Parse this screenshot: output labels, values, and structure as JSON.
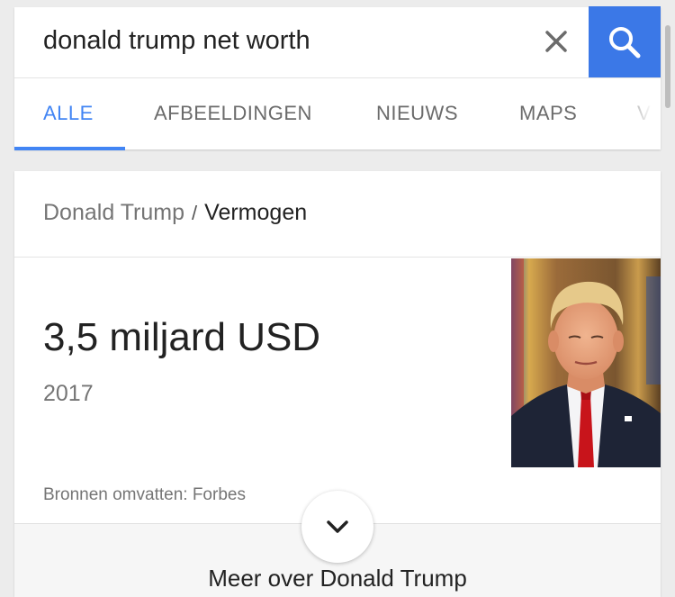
{
  "search": {
    "query": "donald trump net worth"
  },
  "tabs": [
    {
      "label": "ALLE",
      "active": true
    },
    {
      "label": "AFBEELDINGEN",
      "active": false
    },
    {
      "label": "NIEUWS",
      "active": false
    },
    {
      "label": "MAPS",
      "active": false
    },
    {
      "label": "VI",
      "active": false
    }
  ],
  "answer": {
    "breadcrumb_entity": "Donald Trump",
    "breadcrumb_separator": "/",
    "breadcrumb_attribute": "Vermogen",
    "value": "3,5 miljard USD",
    "year": "2017",
    "sources": "Bronnen omvatten: Forbes",
    "more_label": "Meer over Donald Trump"
  },
  "icons": {
    "clear": "close-icon",
    "search": "search-icon",
    "expand": "chevron-down-icon"
  },
  "colors": {
    "accent": "#4285f4",
    "search_button": "#3b78e7"
  }
}
